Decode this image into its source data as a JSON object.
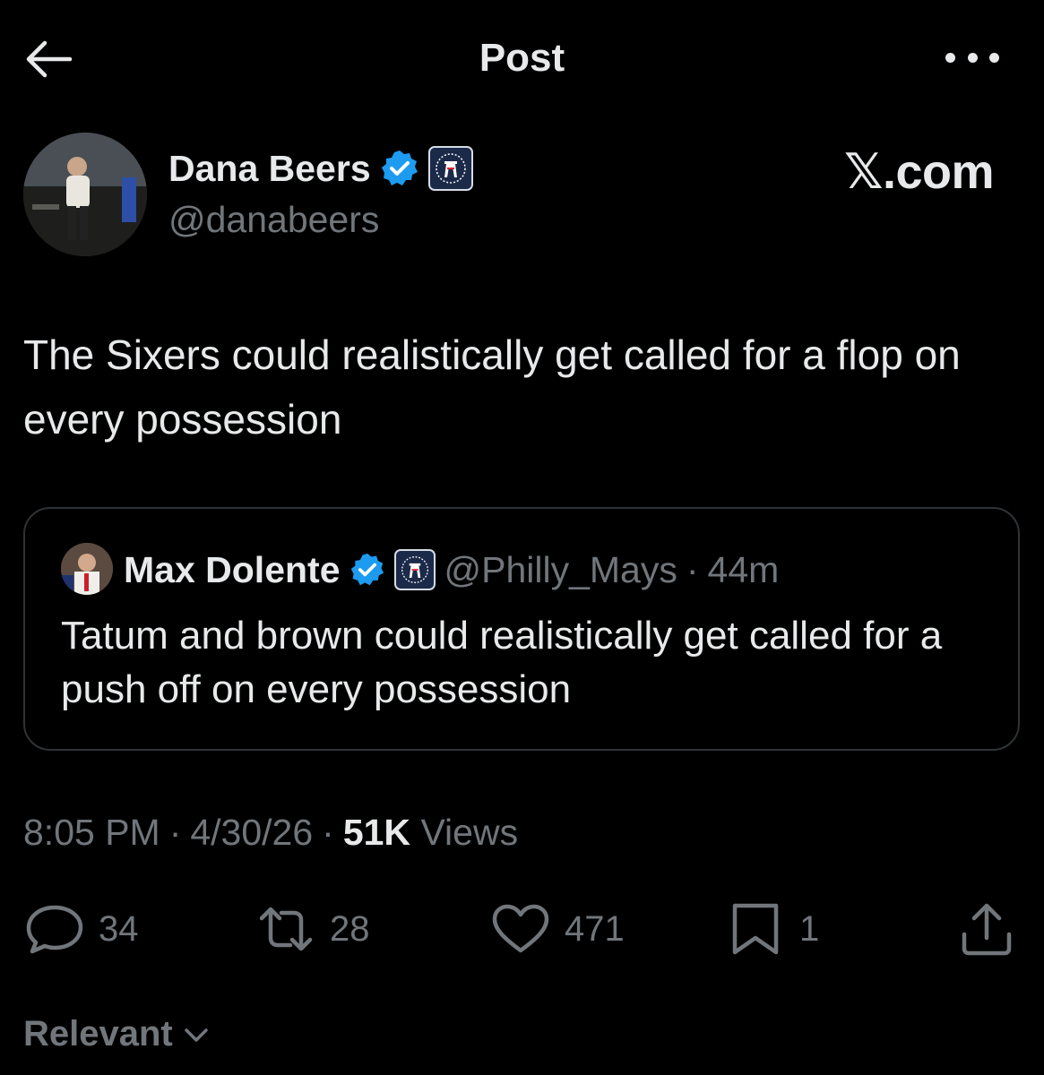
{
  "header": {
    "title": "Post",
    "back_icon": "arrow-left-icon",
    "more_icon": "more-horizontal-icon"
  },
  "watermark": "𝕏.com",
  "author": {
    "name": "Dana Beers",
    "handle": "@danabeers",
    "verified": true,
    "affiliate_badge": "barstool-badge-icon"
  },
  "tweet": {
    "text": "The Sixers could realistically get called for a flop on every possession"
  },
  "quote": {
    "name": "Max Dolente",
    "handle": "@Philly_Mays",
    "separator": "·",
    "time": "44m",
    "text": "Tatum and brown could realistically get called for a push off on every possession",
    "verified": true,
    "affiliate_badge": "barstool-badge-icon"
  },
  "meta": {
    "time": "8:05 PM",
    "sep1": "·",
    "date": "4/30/26",
    "sep2": "·",
    "views_count": "51K",
    "views_label": "Views"
  },
  "actions": {
    "replies": "34",
    "reposts": "28",
    "likes": "471",
    "bookmarks": "1"
  },
  "sort": {
    "label": "Relevant"
  },
  "colors": {
    "background": "#000000",
    "text_primary": "#e7e9ea",
    "text_secondary": "#71767b",
    "verified_blue": "#1d9bf0",
    "border": "#2f3336"
  }
}
